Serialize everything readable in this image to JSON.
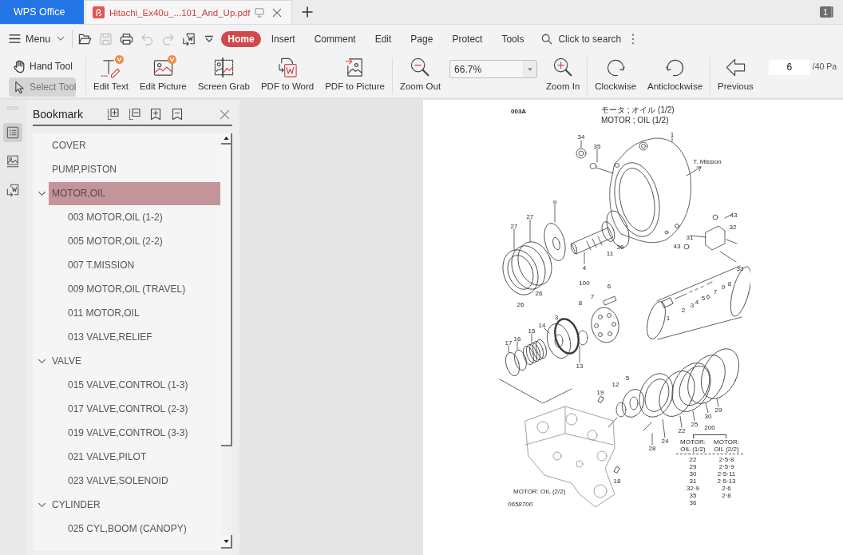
{
  "title_bar": {
    "home_tab": {
      "label": "WPS Office"
    },
    "document_tabs": [
      {
        "label": "Hitachi_Ex40u_...101_And_Up.pdf",
        "selected": true
      }
    ],
    "window_count": "1"
  },
  "menu_bar": {
    "menu_label": "Menu",
    "quick_actions": [
      {
        "disabled": false
      },
      {
        "disabled": true
      },
      {
        "disabled": false
      },
      {
        "disabled": true
      },
      {
        "disabled": true
      },
      {
        "disabled": false
      },
      {
        "disabled": false
      }
    ],
    "ribbon_tabs": [
      {
        "label": "Home",
        "selected": true
      },
      {
        "label": "Insert",
        "selected": false
      },
      {
        "label": "Comment",
        "selected": false
      },
      {
        "label": "Edit",
        "selected": false
      },
      {
        "label": "Page",
        "selected": false
      },
      {
        "label": "Protect",
        "selected": false
      },
      {
        "label": "Tools",
        "selected": false
      }
    ],
    "search": {
      "placeholder": "Click to search"
    }
  },
  "toolbar": {
    "tools": [
      {
        "label": "Hand Tool",
        "selected": false
      },
      {
        "label": "Select Tool",
        "selected": true
      }
    ],
    "groups": [
      [
        {
          "kind": "button",
          "label": "Edit Text",
          "premium": true
        },
        {
          "kind": "button",
          "label": "Edit Picture",
          "premium": true
        },
        {
          "kind": "button",
          "label": "Screen Grab",
          "premium": false
        },
        {
          "kind": "button",
          "label": "PDF to Word",
          "premium": false
        },
        {
          "kind": "button",
          "label": "PDF to Picture",
          "premium": false
        }
      ],
      [
        {
          "kind": "button",
          "label": "Zoom Out",
          "premium": false
        },
        {
          "kind": "combo",
          "value": "66.7%"
        },
        {
          "kind": "button",
          "label": "Zoom In",
          "premium": false
        }
      ],
      [
        {
          "kind": "button",
          "label": "Clockwise",
          "premium": false
        },
        {
          "kind": "button",
          "label": "Anticlockwise",
          "premium": false
        }
      ],
      [
        {
          "kind": "button",
          "label": "Previous",
          "premium": false
        },
        {
          "kind": "page_field",
          "value": "6"
        },
        {
          "kind": "text",
          "label": "/40 Pa"
        }
      ]
    ]
  },
  "side_rail": [
    {
      "selected": true
    },
    {
      "selected": false
    },
    {
      "selected": false
    }
  ],
  "bookmark_panel": {
    "title": "Bookmark",
    "items": [
      {
        "label": "COVER",
        "selected": false
      },
      {
        "label": "PUMP,PISTON",
        "selected": false
      },
      {
        "label": "MOTOR,OIL",
        "selected": true,
        "expanded": true,
        "children": [
          {
            "label": "003 MOTOR,OIL (1-2)",
            "selected": false
          },
          {
            "label": "005 MOTOR,OIL (2-2)",
            "selected": false
          },
          {
            "label": "007 T.MISSION",
            "selected": false
          },
          {
            "label": "009 MOTOR,OIL (TRAVEL)",
            "selected": false
          },
          {
            "label": "011 MOTOR,OIL",
            "selected": false
          },
          {
            "label": "013 VALVE,RELIEF",
            "selected": false
          }
        ]
      },
      {
        "label": "VALVE",
        "selected": false,
        "expanded": true,
        "children": [
          {
            "label": "015 VALVE,CONTROL (1-3)",
            "selected": false
          },
          {
            "label": "017 VALVE,CONTROL (2-3)",
            "selected": false
          },
          {
            "label": "019 VALVE,CONTROL (3-3)",
            "selected": false
          },
          {
            "label": "021 VALVE,PILOT",
            "selected": false
          },
          {
            "label": "023 VALVE,SOLENOID",
            "selected": false
          }
        ]
      },
      {
        "label": "CYLINDER",
        "selected": false,
        "expanded": true,
        "children": [
          {
            "label": "025 CYL,BOOM (CANOPY)",
            "selected": false
          }
        ]
      }
    ]
  },
  "document_page": {
    "page_code": "003A",
    "title_lines": [
      "モータ ; オイル (1/2)",
      "MOTOR ; OIL (1/2)"
    ],
    "callouts": [
      "34",
      "35",
      "1",
      "T. Mission",
      "9",
      "27",
      "27",
      "43",
      "32",
      "31",
      "36",
      "11",
      "43",
      "4",
      "33",
      "26",
      "26",
      "100",
      "6",
      "8",
      "9",
      "7",
      "6",
      "5",
      "4",
      "3",
      "2",
      "1",
      "3",
      "8",
      "7",
      "14",
      "15",
      "16",
      "17",
      "13",
      "5",
      "12",
      "19",
      "29",
      "30",
      "25",
      "22",
      "24",
      "28",
      "18"
    ],
    "legend": {
      "group": "200",
      "columns": [
        {
          "header": "MOTOR: OIL (1/2)",
          "values": [
            "22",
            "29",
            "30",
            "31",
            "32·9",
            "35",
            "36"
          ]
        },
        {
          "header": "MOTOR: OIL (2/2)",
          "values": [
            "2·5·8",
            "2·5·9",
            "2·5·11",
            "2·5·13",
            "2·6",
            "2·8"
          ]
        }
      ]
    },
    "caption": "MOTOR: OIL (2/2)",
    "drawing_number": "0658700"
  }
}
